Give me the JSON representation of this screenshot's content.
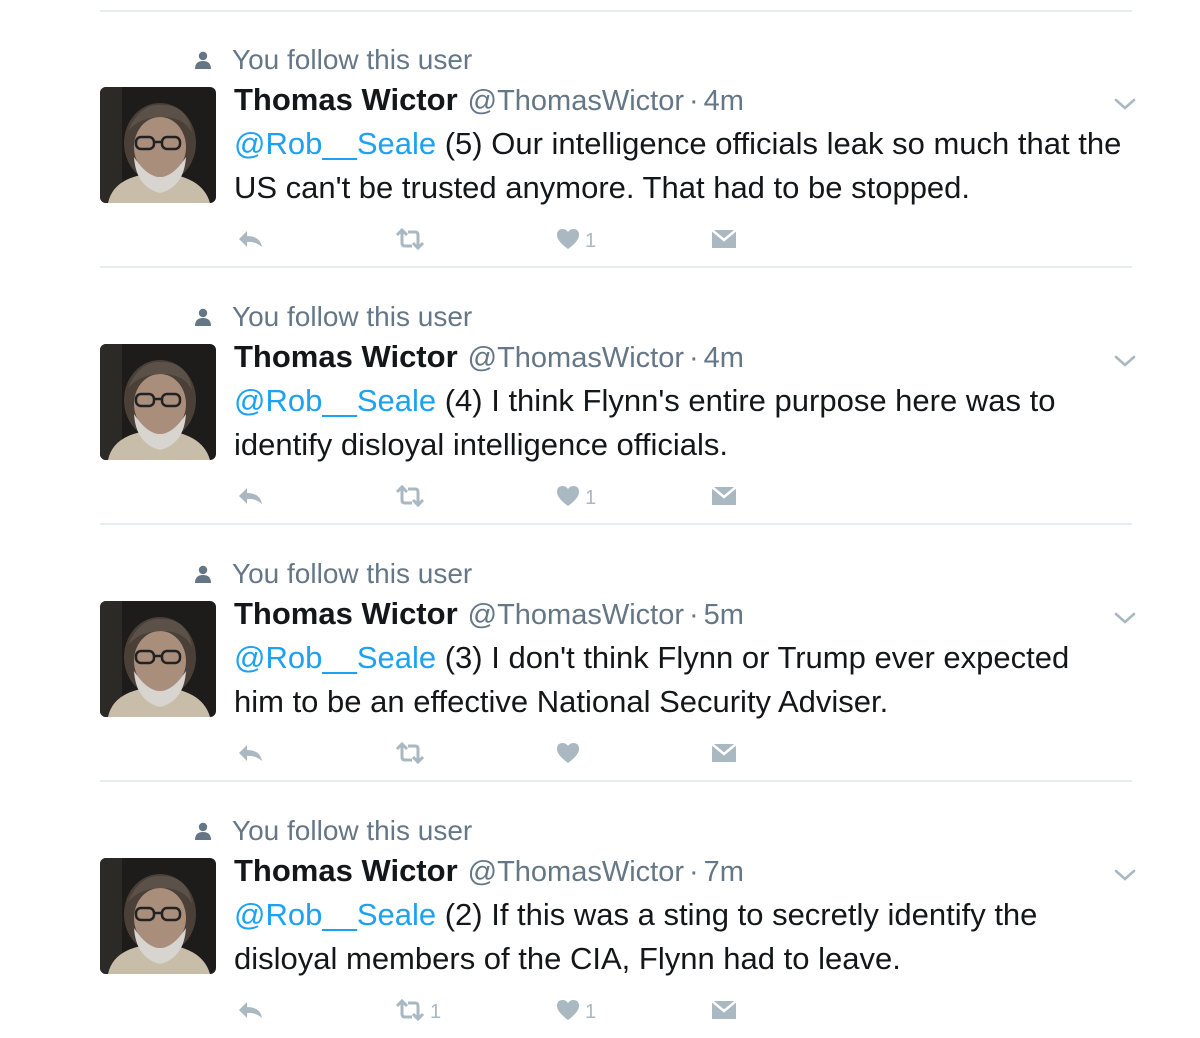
{
  "colors": {
    "link": "#1da1f2",
    "muted": "#657786",
    "icon": "#aab8c2",
    "divider": "#e6ecf0"
  },
  "tweets": [
    {
      "context": "You follow this user",
      "name": "Thomas Wictor",
      "handle": "@ThomasWictor",
      "separator": "·",
      "time": "4m",
      "mention": "@Rob__Seale",
      "text": " (5) Our intelligence officials leak so much that the US can't be trusted anymore. That had to be stopped.",
      "retweets": "",
      "likes": "1"
    },
    {
      "context": "You follow this user",
      "name": "Thomas Wictor",
      "handle": "@ThomasWictor",
      "separator": "·",
      "time": "4m",
      "mention": "@Rob__Seale",
      "text": " (4) I think Flynn's entire purpose here was to identify disloyal intelligence officials.",
      "retweets": "",
      "likes": "1"
    },
    {
      "context": "You follow this user",
      "name": "Thomas Wictor",
      "handle": "@ThomasWictor",
      "separator": "·",
      "time": "5m",
      "mention": "@Rob__Seale",
      "text": " (3) I don't think Flynn or Trump ever expected him to be an effective National Security Adviser.",
      "retweets": "",
      "likes": ""
    },
    {
      "context": "You follow this user",
      "name": "Thomas Wictor",
      "handle": "@ThomasWictor",
      "separator": "·",
      "time": "7m",
      "mention": "@Rob__Seale",
      "text": " (2) If this was a sting to secretly identify the disloyal members of the CIA, Flynn had to leave.",
      "retweets": "1",
      "likes": "1"
    }
  ]
}
